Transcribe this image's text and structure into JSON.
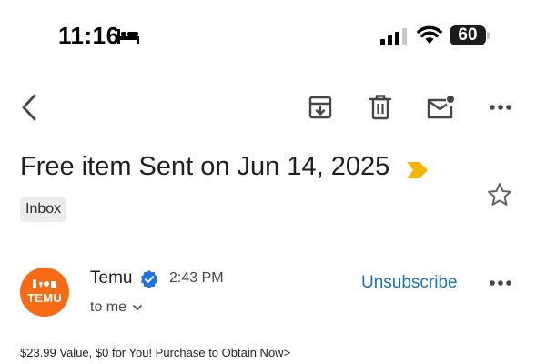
{
  "status_bar": {
    "time": "11:16",
    "battery_level": "60",
    "icons": [
      "bed-icon",
      "cellular-signal-icon",
      "wifi-icon",
      "battery-icon"
    ]
  },
  "toolbar": {
    "icons": [
      "back-arrow-icon",
      "archive-icon",
      "trash-icon",
      "mark-unread-icon",
      "more-icon"
    ]
  },
  "email": {
    "subject": "Free item Sent on Jun 14, 2025",
    "label_chip": "Inbox",
    "sender": "Temu",
    "time": "2:43 PM",
    "recipient": "to me",
    "unsubscribe_label": "Unsubscribe",
    "avatar_text": "TEMU",
    "preview": "$23.99 Value, $0 for You! Purchase to Obtain Now>"
  },
  "colors": {
    "important_marker": "#f5b400",
    "avatar_bg": "#f66a14",
    "link": "#1a73b8",
    "verified": "#1a73e8"
  }
}
